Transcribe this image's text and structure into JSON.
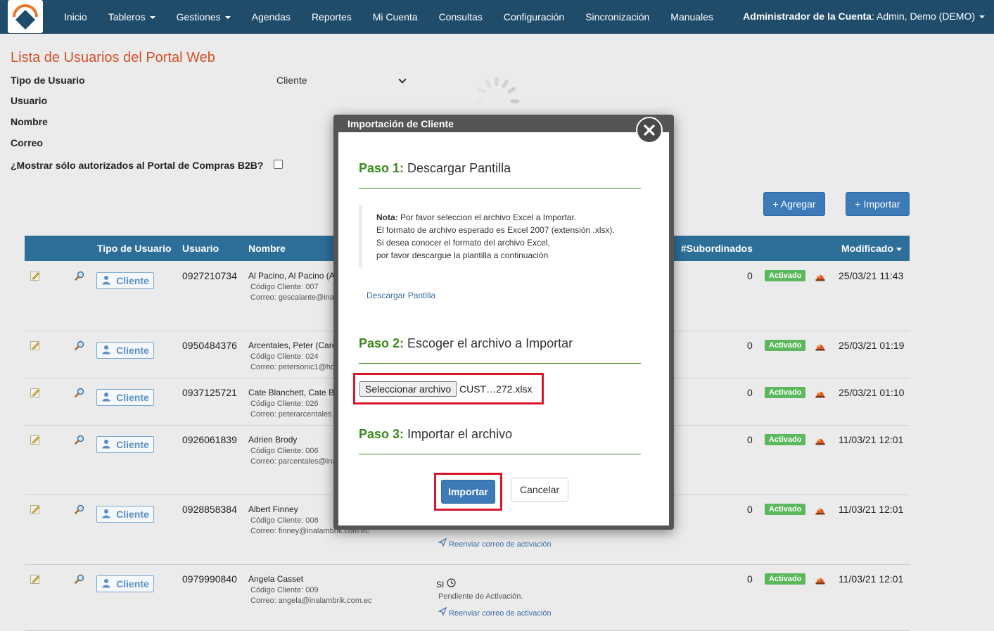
{
  "nav": {
    "items": [
      {
        "label": "Inicio",
        "caret": false
      },
      {
        "label": "Tableros",
        "caret": true
      },
      {
        "label": "Gestiones",
        "caret": true
      },
      {
        "label": "Agendas",
        "caret": false
      },
      {
        "label": "Reportes",
        "caret": false
      },
      {
        "label": "Mi Cuenta",
        "caret": false
      },
      {
        "label": "Consultas",
        "caret": false
      },
      {
        "label": "Configuración",
        "caret": false
      },
      {
        "label": "Sincronización",
        "caret": false
      },
      {
        "label": "Manuales",
        "caret": false
      }
    ],
    "account_role": "Administrador de la Cuenta",
    "account_name": ": Admin, Demo (DEMO)"
  },
  "page": {
    "title": "Lista de Usuarios del Portal Web",
    "filters": {
      "tipo_label": "Tipo de Usuario",
      "tipo_value": "Cliente",
      "usuario_label": "Usuario",
      "nombre_label": "Nombre",
      "correo_label": "Correo",
      "b2b_label": "¿Mostrar sólo autorizados al Portal de Compras B2B?"
    },
    "add_button": "+ Agregar",
    "import_button": "+ Importar"
  },
  "table": {
    "headers": {
      "tipo": "Tipo de Usuario",
      "usuario": "Usuario",
      "nombre": "Nombre",
      "subordinados": "#Subordinados",
      "modificado": "Modificado"
    },
    "tipo_button": "Cliente",
    "status_badge": "Activado",
    "rows": [
      {
        "usuario": "0927210734",
        "nombre": "Al Pacino, Al Pacino (A",
        "codigo": "Código Cliente: 007",
        "correo": "Correo: gescalante@ina",
        "subordinados": "0",
        "modificado": "25/03/21 11:43"
      },
      {
        "usuario": "0950484376",
        "nombre": "Arcentales, Peter (Care",
        "codigo": "Código Cliente: 024",
        "correo": "Correo: petersonic1@ho",
        "subordinados": "0",
        "modificado": "25/03/21 01:19"
      },
      {
        "usuario": "0937125721",
        "nombre": "Cate Blanchett, Cate B",
        "codigo": "Código Cliente: 026",
        "correo": "Correo: peterarcentales",
        "subordinados": "0",
        "modificado": "25/03/21 01:10"
      },
      {
        "usuario": "0926061839",
        "nombre": "Adrien Brody",
        "codigo": "Código Cliente: 006",
        "correo": "Correo: parcentales@ina",
        "subordinados": "0",
        "modificado": "11/03/21 12:01"
      },
      {
        "usuario": "0928858384",
        "nombre": "Albert Finney",
        "codigo": "Código Cliente: 008",
        "correo": "Correo: finney@inalambrik.com.ec",
        "subordinados": "0",
        "modificado": "11/03/21 12:01"
      },
      {
        "usuario": "0979990840",
        "nombre": "Angela Casset",
        "codigo": "Código Cliente: 009",
        "correo": "Correo: angela@inalambrik.com.ec",
        "subordinados": "0",
        "modificado": "11/03/21 12:01"
      }
    ],
    "row5_resend": "Reenviar correo de activación",
    "row6_si": "SI",
    "row6_pending": "Pendiente de Activación.",
    "row6_resend": "Reenviar correo de activación"
  },
  "modal": {
    "title": "Importación de Cliente",
    "step1_label": "Paso 1:",
    "step1_text": " Descargar Pantilla",
    "note_label": "Nota:",
    "note_line1": " Por favor seleccion el archivo Excel a Importar.",
    "note_line2": "El formato de archivo esperado es Excel 2007 (extensión .xlsx).",
    "note_line3": "Si desea conocer el formato del archivo Excel,",
    "note_line4": "por favor descargue la plantilla a continuación",
    "download_link": "Descargar Pantilla",
    "step2_label": "Paso 2:",
    "step2_text": " Escoger el archivo a Importar",
    "file_button": "Seleccionar archivo",
    "file_name": "CUST…272.xlsx",
    "step3_label": "Paso 3:",
    "step3_text": " Importar el archivo",
    "import_button": "Importar",
    "cancel_button": "Cancelar"
  },
  "colors": {
    "navbar": "#1f4c6b",
    "title": "#d2502b",
    "table_header": "#2d6f99",
    "step_green": "#3b8a1d",
    "highlight_red": "#d9162a",
    "badge_green": "#5cb85c"
  }
}
